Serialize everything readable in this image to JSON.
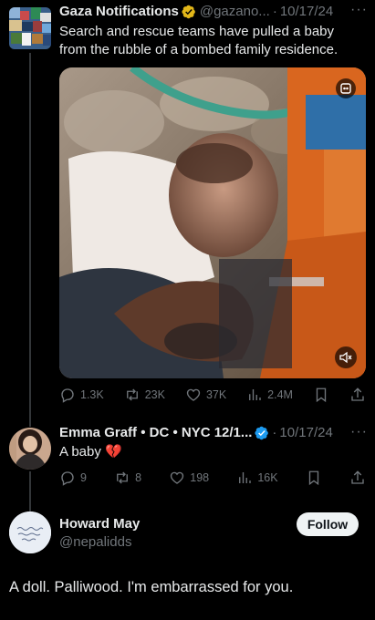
{
  "tweet1": {
    "name": "Gaza Notifications",
    "handle": "@gazano...",
    "date": "10/17/24",
    "text_line1": "Search and rescue teams have pulled a baby",
    "text_line2": "from the rubble of a bombed family residence.",
    "replies": "1.3K",
    "reposts": "23K",
    "likes": "37K",
    "views": "2.4M"
  },
  "tweet2": {
    "name": "Emma Graff • DC • NYC 12/1...",
    "date": "10/17/24",
    "text": "A baby",
    "emoji": "💔",
    "replies": "9",
    "reposts": "8",
    "likes": "198",
    "views": "16K"
  },
  "tweet3": {
    "name": "Howard May",
    "handle": "@nepalidds",
    "follow_label": "Follow",
    "text": "A doll. Palliwood. I'm embarrassed for you."
  },
  "icons": {
    "verified": "verified-badge-icon",
    "reply": "reply-icon",
    "repost": "repost-icon",
    "like": "heart-icon",
    "views": "views-icon",
    "bookmark": "bookmark-icon",
    "share": "share-icon",
    "more": "more-icon",
    "mute": "mute-icon",
    "expand": "expand-icon"
  },
  "colors": {
    "background": "#000000",
    "text": "#e7e9ea",
    "secondary": "#71767b",
    "verified_blue": "#1d9bf0",
    "verified_gold": "#e2b719",
    "follow_bg": "#eff3f4"
  }
}
